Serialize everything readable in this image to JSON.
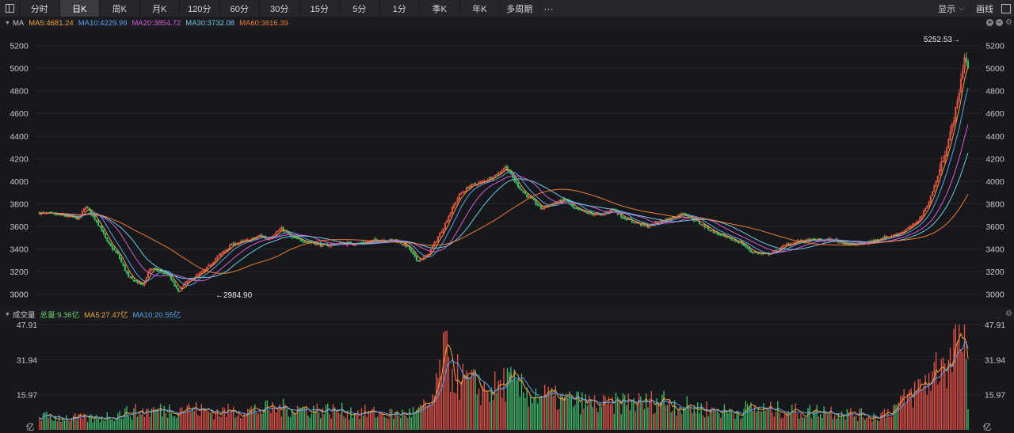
{
  "toolbar": {
    "tabs": [
      "分时",
      "日K",
      "周K",
      "月K",
      "120分",
      "60分",
      "30分",
      "15分",
      "5分",
      "1分",
      "季K",
      "年K",
      "多周期"
    ],
    "active_index": 1,
    "more": "···",
    "display_label": "显示",
    "draw_label": "画线"
  },
  "price_legend": {
    "title": "MA",
    "items": [
      {
        "text": "MA5:4681.24",
        "color": "#f2a33a"
      },
      {
        "text": "MA10:4229.99",
        "color": "#5aa0f0"
      },
      {
        "text": "MA20:3854.72",
        "color": "#d85ad8"
      },
      {
        "text": "MA30:3732.08",
        "color": "#6cc8e8"
      },
      {
        "text": "MA60:3616.39",
        "color": "#f07c30"
      }
    ]
  },
  "volume_legend": {
    "title": "成交量",
    "items": [
      {
        "text": "总量:9.36亿",
        "color": "#6ad06a"
      },
      {
        "text": "MA5:27.47亿",
        "color": "#f2a33a"
      },
      {
        "text": "MA10:20.55亿",
        "color": "#5aa0f0"
      }
    ]
  },
  "colors": {
    "up": "#e05046",
    "down": "#3fb868",
    "grid": "#24262b",
    "axis_text": "#c8c8c8"
  },
  "chart_data": [
    {
      "type": "candlestick",
      "ylim": [
        2900,
        5330
      ],
      "yticks": [
        3000,
        3200,
        3400,
        3600,
        3800,
        4000,
        4200,
        4400,
        4600,
        4800,
        5000,
        5200
      ],
      "annotations": [
        {
          "text": "5252.53→",
          "value": 5252.53
        },
        {
          "text": "←2984.90",
          "value": 2984.9
        }
      ],
      "anchors": [
        [
          0,
          3720
        ],
        [
          12,
          3700
        ],
        [
          22,
          3670
        ],
        [
          26,
          3780
        ],
        [
          34,
          3600
        ],
        [
          38,
          3460
        ],
        [
          44,
          3350
        ],
        [
          50,
          3150
        ],
        [
          58,
          3080
        ],
        [
          62,
          3230
        ],
        [
          72,
          3180
        ],
        [
          78,
          3020
        ],
        [
          82,
          3100
        ],
        [
          92,
          3200
        ],
        [
          100,
          3330
        ],
        [
          108,
          3440
        ],
        [
          118,
          3480
        ],
        [
          124,
          3520
        ],
        [
          128,
          3490
        ],
        [
          136,
          3580
        ],
        [
          142,
          3500
        ],
        [
          152,
          3460
        ],
        [
          160,
          3430
        ],
        [
          170,
          3450
        ],
        [
          180,
          3450
        ],
        [
          190,
          3480
        ],
        [
          200,
          3480
        ],
        [
          207,
          3420
        ],
        [
          212,
          3300
        ],
        [
          218,
          3340
        ],
        [
          226,
          3560
        ],
        [
          232,
          3760
        ],
        [
          236,
          3880
        ],
        [
          242,
          3960
        ],
        [
          250,
          4000
        ],
        [
          258,
          4070
        ],
        [
          262,
          4130
        ],
        [
          268,
          3980
        ],
        [
          272,
          3900
        ],
        [
          278,
          3820
        ],
        [
          282,
          3760
        ],
        [
          288,
          3800
        ],
        [
          296,
          3840
        ],
        [
          300,
          3760
        ],
        [
          308,
          3720
        ],
        [
          316,
          3700
        ],
        [
          322,
          3760
        ],
        [
          328,
          3680
        ],
        [
          334,
          3640
        ],
        [
          342,
          3600
        ],
        [
          348,
          3640
        ],
        [
          356,
          3680
        ],
        [
          362,
          3720
        ],
        [
          370,
          3640
        ],
        [
          378,
          3560
        ],
        [
          386,
          3500
        ],
        [
          394,
          3460
        ],
        [
          400,
          3380
        ],
        [
          408,
          3350
        ],
        [
          414,
          3380
        ],
        [
          420,
          3440
        ],
        [
          428,
          3470
        ],
        [
          436,
          3480
        ],
        [
          446,
          3480
        ],
        [
          456,
          3440
        ],
        [
          464,
          3450
        ],
        [
          474,
          3500
        ],
        [
          480,
          3520
        ],
        [
          486,
          3560
        ],
        [
          492,
          3620
        ],
        [
          496,
          3700
        ],
        [
          500,
          3820
        ],
        [
          504,
          4000
        ],
        [
          508,
          4200
        ],
        [
          512,
          4420
        ],
        [
          516,
          4700
        ],
        [
          520,
          5100
        ],
        [
          522,
          5000
        ]
      ]
    },
    {
      "type": "bar",
      "ylim": [
        0,
        47.91
      ],
      "yticks": [
        "47.91",
        "31.94",
        "15.97"
      ],
      "unit": "亿",
      "anchors": [
        [
          0,
          6
        ],
        [
          30,
          5
        ],
        [
          50,
          8
        ],
        [
          70,
          9
        ],
        [
          80,
          10
        ],
        [
          100,
          8
        ],
        [
          120,
          9
        ],
        [
          140,
          10
        ],
        [
          160,
          9
        ],
        [
          180,
          8
        ],
        [
          200,
          7
        ],
        [
          212,
          8
        ],
        [
          220,
          12
        ],
        [
          224,
          20
        ],
        [
          226,
          35
        ],
        [
          230,
          30
        ],
        [
          234,
          25
        ],
        [
          238,
          22
        ],
        [
          244,
          20
        ],
        [
          250,
          18
        ],
        [
          258,
          19
        ],
        [
          262,
          22
        ],
        [
          270,
          18
        ],
        [
          280,
          16
        ],
        [
          290,
          14
        ],
        [
          300,
          13
        ],
        [
          310,
          12
        ],
        [
          320,
          11
        ],
        [
          330,
          13
        ],
        [
          340,
          12
        ],
        [
          350,
          14
        ],
        [
          360,
          11
        ],
        [
          370,
          10
        ],
        [
          380,
          9
        ],
        [
          390,
          8
        ],
        [
          400,
          10
        ],
        [
          410,
          9
        ],
        [
          420,
          9
        ],
        [
          430,
          8
        ],
        [
          440,
          9
        ],
        [
          450,
          8
        ],
        [
          460,
          7
        ],
        [
          470,
          6
        ],
        [
          478,
          9
        ],
        [
          484,
          12
        ],
        [
          490,
          16
        ],
        [
          496,
          20
        ],
        [
          502,
          25
        ],
        [
          508,
          33
        ],
        [
          512,
          30
        ],
        [
          516,
          47.91
        ],
        [
          520,
          38
        ],
        [
          522,
          9.36
        ]
      ]
    }
  ]
}
